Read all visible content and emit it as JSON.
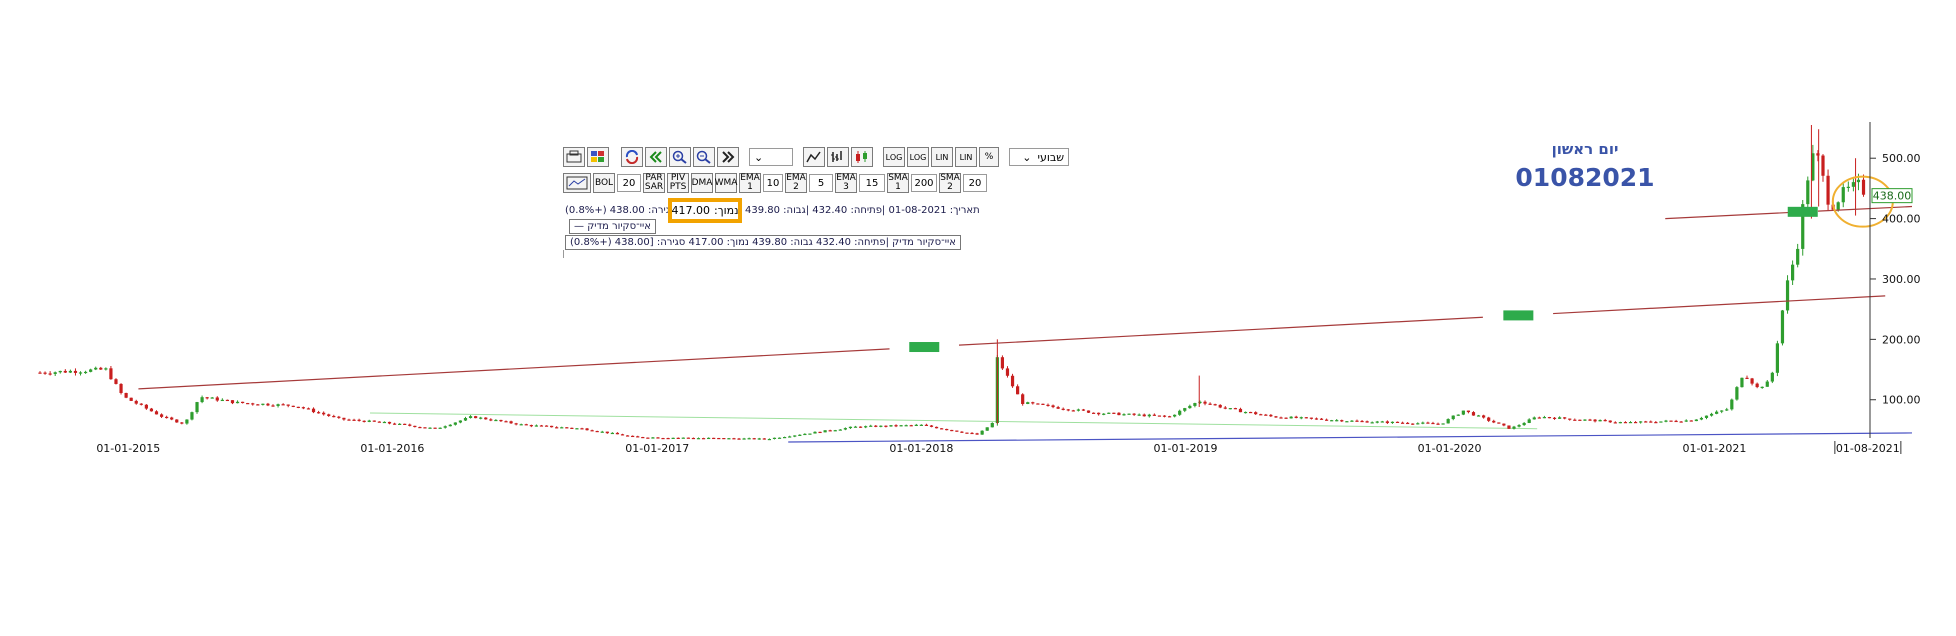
{
  "toolbar": {
    "period_select": "שבועי",
    "sma_labels": [
      "SMA 1",
      "SMA 2"
    ],
    "ema_labels": [
      "EMA 1",
      "EMA 2",
      "EMA 3"
    ],
    "buttons": {
      "bol": "BOL",
      "par_sar": "PAR SAR",
      "piv_pts": "PIV PTS",
      "dma": "DMA",
      "wma": "WMA",
      "log1": "LOG",
      "log2": "LOG",
      "lin1": "LIN",
      "lin2": "LIN",
      "percent": "%"
    },
    "fields": {
      "bol": "20",
      "ema1": "10",
      "ema2": "5",
      "ema3": "15",
      "sma1": "200",
      "sma2": "20"
    },
    "info_line": "תאריך: 01-08-2021 |פתיחה: 432.40 |גבוה: 439.80",
    "info_close": "סגירה: 438.00 (+0.8%)",
    "low_label": "נמוך:",
    "low_value": "417.00",
    "legend_label": "איי־סקיור מדיק",
    "legend_line": "איי־סקיור מדיק |פתיחה: 432.40  גבוה: 439.80  נמוך: 417.00  סגירה: [438.00 (+0.8%)"
  },
  "annotation": {
    "day_text": "יום ראשון",
    "date_text": "01082021"
  },
  "colors": {
    "up": "#2e9d2e",
    "down": "#c81e1e",
    "trend_line": "#a63a3a",
    "support_line": "#4b54c4",
    "ma_line": "#9fe09f",
    "marker": "#2eab4b",
    "circle": "#f0b030",
    "highlight": "#f2a300"
  },
  "chart_data": {
    "type": "candlestick",
    "title": "",
    "xlabel": "",
    "ylabel": "",
    "y_axis": "right",
    "ylim": [
      30,
      555
    ],
    "yticks": [
      100,
      200,
      300,
      400,
      500
    ],
    "ytick_labels": [
      "100.00",
      "200.00",
      "300.00",
      "400.00",
      "500.00"
    ],
    "x_tick_labels": [
      "01-01-2015",
      "01-01-2016",
      "01-01-2017",
      "01-01-2018",
      "01-01-2019",
      "01-01-2020",
      "01-01-2021",
      "01-08-2021"
    ],
    "current_value": 438.0,
    "current_value_label": "438.00",
    "xlim": [
      "2014-09-01",
      "2021-10-01"
    ],
    "series_keyframes": [
      [
        "2014-09-01",
        145
      ],
      [
        "2014-12-01",
        150
      ],
      [
        "2014-12-25",
        105
      ],
      [
        "2015-02-20",
        70
      ],
      [
        "2015-03-20",
        60
      ],
      [
        "2015-04-10",
        105
      ],
      [
        "2015-06-01",
        95
      ],
      [
        "2015-08-20",
        90
      ],
      [
        "2015-10-20",
        68
      ],
      [
        "2015-12-20",
        62
      ],
      [
        "2016-03-01",
        52
      ],
      [
        "2016-04-20",
        72
      ],
      [
        "2016-07-01",
        58
      ],
      [
        "2016-09-20",
        52
      ],
      [
        "2016-12-01",
        38
      ],
      [
        "2017-06-01",
        35
      ],
      [
        "2017-10-01",
        55
      ],
      [
        "2018-01-01",
        58
      ],
      [
        "2018-03-20",
        42
      ],
      [
        "2018-04-10",
        62
      ],
      [
        "2018-04-16",
        168
      ],
      [
        "2018-05-20",
        95
      ],
      [
        "2018-09-01",
        78
      ],
      [
        "2018-12-10",
        72
      ],
      [
        "2019-01-20",
        98
      ],
      [
        "2019-03-01",
        85
      ],
      [
        "2019-05-01",
        72
      ],
      [
        "2019-09-01",
        64
      ],
      [
        "2019-12-20",
        60
      ],
      [
        "2020-01-20",
        82
      ],
      [
        "2020-03-25",
        52
      ],
      [
        "2020-05-01",
        72
      ],
      [
        "2020-09-01",
        62
      ],
      [
        "2020-12-01",
        66
      ],
      [
        "2021-01-20",
        85
      ],
      [
        "2021-02-10",
        145
      ],
      [
        "2021-03-01",
        120
      ],
      [
        "2021-03-20",
        130
      ],
      [
        "2021-04-10",
        285
      ],
      [
        "2021-04-25",
        350
      ],
      [
        "2021-05-08",
        460
      ],
      [
        "2021-05-20",
        515
      ],
      [
        "2021-06-10",
        420
      ],
      [
        "2021-07-01",
        445
      ],
      [
        "2021-07-20",
        455
      ],
      [
        "2021-08-01",
        438
      ]
    ],
    "trend_lines": [
      {
        "from": [
          "2015-01-15",
          118
        ],
        "to": [
          "2021-08-25",
          272
        ]
      },
      {
        "from": [
          "2020-10-25",
          400
        ],
        "to": [
          "2021-10-01",
          420
        ]
      }
    ],
    "support_line": {
      "from": [
        "2017-07-01",
        30
      ],
      "to": [
        "2021-10-01",
        45
      ]
    },
    "ma_line": {
      "from": [
        "2015-12-01",
        78
      ],
      "to": [
        "2020-05-01",
        52
      ]
    }
  }
}
